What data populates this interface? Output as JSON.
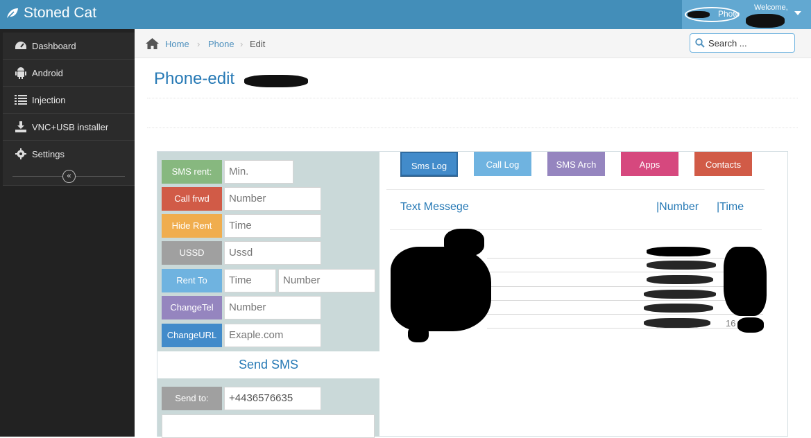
{
  "app": {
    "title": "Stoned Cat"
  },
  "user": {
    "welcome": "Welcome,",
    "photo_label": "Photo"
  },
  "sidebar": {
    "items": [
      {
        "label": "Dashboard",
        "icon": "dashboard-icon"
      },
      {
        "label": "Android",
        "icon": "android-icon"
      },
      {
        "label": "Injection",
        "icon": "list-icon"
      },
      {
        "label": "VNC+USB installer",
        "icon": "download-icon"
      },
      {
        "label": "Settings",
        "icon": "gear-icon"
      }
    ],
    "collapse_glyph": "«"
  },
  "breadcrumb": {
    "home": "Home",
    "phone": "Phone",
    "current": "Edit",
    "separator": "›"
  },
  "search": {
    "placeholder": "Search ..."
  },
  "page": {
    "title": "Phone-edit"
  },
  "controls": {
    "sms_rent": {
      "label": "SMS rent:",
      "placeholder": "Min."
    },
    "call_frwd": {
      "label": "Call frwd",
      "placeholder": "Number"
    },
    "hide_rent": {
      "label": "Hide Rent",
      "placeholder": "Time"
    },
    "ussd": {
      "label": "USSD",
      "placeholder": "Ussd"
    },
    "rent_to": {
      "label": "Rent To",
      "placeholder_time": "Time",
      "placeholder_number": "Number"
    },
    "change_tel": {
      "label": "ChangeTel",
      "placeholder": "Number"
    },
    "change_url": {
      "label": "ChangeURL",
      "placeholder": "Exaple.com"
    }
  },
  "send_sms": {
    "title": "Send SMS",
    "send_to_label": "Send to:",
    "send_to_value": "+4436576635"
  },
  "tabs": [
    {
      "label": "Sms Log",
      "color": "#428bca",
      "active": true
    },
    {
      "label": "Call Log",
      "color": "#6fb3e0",
      "active": false
    },
    {
      "label": "SMS Arch",
      "color": "#9585bf",
      "active": false
    },
    {
      "label": "Apps",
      "color": "#d6487e",
      "active": false
    },
    {
      "label": "Contacts",
      "color": "#d15b47",
      "active": false
    }
  ],
  "log_table": {
    "col_text": "Text Messege",
    "col_number": "|Number",
    "col_time": "|Time",
    "last_time_visible": "16"
  },
  "colors": {
    "topbar": "#438eb9",
    "sidebar": "#222222",
    "title": "#2679b5",
    "btn_green": "#87b87f",
    "btn_red": "#d15b47",
    "btn_orange": "#f0ad4e",
    "btn_grey": "#a0a0a0",
    "btn_lightblue": "#6fb3e0",
    "btn_purple": "#9585bf",
    "btn_blue": "#428bca"
  }
}
